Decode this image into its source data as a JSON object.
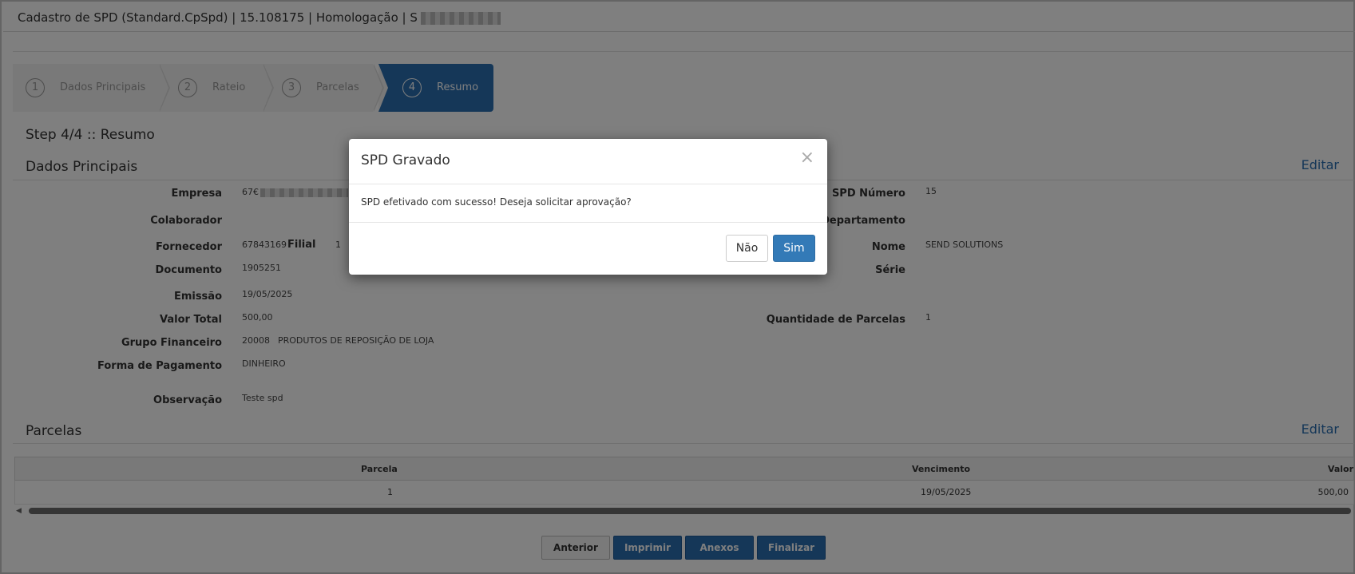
{
  "titlebar": {
    "title": "Cadastro de SPD (Standard.CpSpd) | 15.108175 | Homologação | S"
  },
  "wizard": {
    "steps": [
      {
        "num": "1",
        "label": "Dados Principais"
      },
      {
        "num": "2",
        "label": "Rateio"
      },
      {
        "num": "3",
        "label": "Parcelas"
      },
      {
        "num": "4",
        "label": "Resumo"
      }
    ]
  },
  "step_heading": "Step 4/4 :: Resumo",
  "dados": {
    "title": "Dados Principais",
    "edit": "Editar",
    "labels": {
      "empresa": "Empresa",
      "colaborador": "Colaborador",
      "fornecedor": "Fornecedor",
      "filial": "Filial",
      "documento": "Documento",
      "emissao": "Emissão",
      "valor_total": "Valor Total",
      "grupo_financeiro": "Grupo Financeiro",
      "forma_pagamento": "Forma de Pagamento",
      "observacao": "Observação",
      "spd_numero": "SPD Número",
      "departamento": "Departamento",
      "nome": "Nome",
      "serie": "Série",
      "qtd_parcelas": "Quantidade de Parcelas"
    },
    "values": {
      "empresa": "67€",
      "fornecedor": "67843169",
      "filial": "1",
      "documento": "1905251",
      "emissao": "19/05/2025",
      "valor_total": "500,00",
      "grupo_codigo": "20008",
      "grupo_nome": "PRODUTOS DE REPOSIÇÃO DE LOJA",
      "forma_pagamento": "DINHEIRO",
      "observacao": "Teste spd",
      "spd_numero": "15",
      "nome": "SEND SOLUTIONS",
      "qtd_parcelas": "1"
    }
  },
  "parcelas": {
    "title": "Parcelas",
    "edit": "Editar",
    "columns": [
      "Parcela",
      "Vencimento",
      "Valor"
    ],
    "rows": [
      {
        "parcela": "1",
        "vencimento": "19/05/2025",
        "valor": "500,00"
      }
    ]
  },
  "footer": {
    "anterior": "Anterior",
    "imprimir": "Imprimir",
    "anexos": "Anexos",
    "finalizar": "Finalizar"
  },
  "modal": {
    "title": "SPD Gravado",
    "close": "×",
    "message": "SPD efetivado com sucesso! Deseja solicitar aprovação?",
    "nao": "Não",
    "sim": "Sim"
  }
}
